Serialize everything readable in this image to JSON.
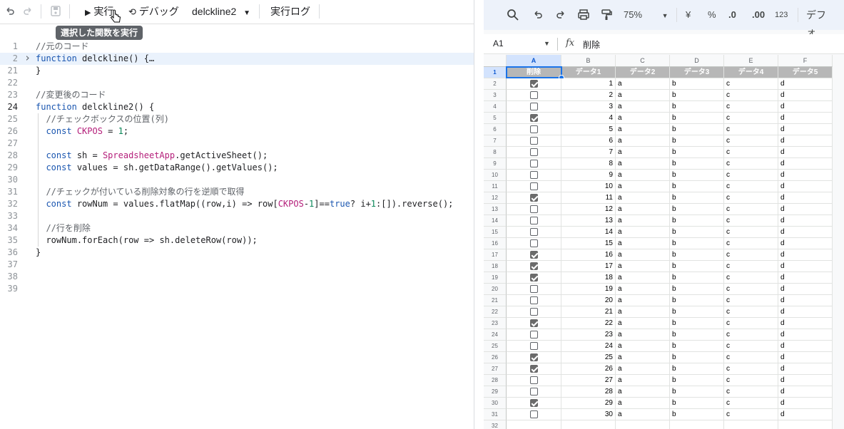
{
  "editor": {
    "toolbar": {
      "run_label": "実行",
      "debug_label": "デバッグ",
      "function_select": "delckline2",
      "log_label": "実行ログ"
    },
    "tooltip": "選択した関数を実行",
    "lines": [
      {
        "n": "1",
        "t": "//元のコード"
      },
      {
        "n": "2",
        "t": "function delckline() {…"
      },
      {
        "n": "21",
        "t": "}"
      },
      {
        "n": "22",
        "t": ""
      },
      {
        "n": "23",
        "t": "//変更後のコード"
      },
      {
        "n": "24",
        "t": "function delckline2() {"
      },
      {
        "n": "25",
        "t": "  //チェックボックスの位置(列)"
      },
      {
        "n": "26",
        "t": "  const CKPOS = 1;"
      },
      {
        "n": "27",
        "t": ""
      },
      {
        "n": "28",
        "t": "  const sh = SpreadsheetApp.getActiveSheet();"
      },
      {
        "n": "29",
        "t": "  const values = sh.getDataRange().getValues();"
      },
      {
        "n": "30",
        "t": ""
      },
      {
        "n": "31",
        "t": "  //チェックが付いている削除対象の行を逆順で取得"
      },
      {
        "n": "32",
        "t": "  const rowNum = values.flatMap((row,i) => row[CKPOS-1]==true? i+1:[]).reverse();"
      },
      {
        "n": "33",
        "t": ""
      },
      {
        "n": "34",
        "t": "  //行を削除"
      },
      {
        "n": "35",
        "t": "  rowNum.forEach(row => sh.deleteRow(row));"
      },
      {
        "n": "36",
        "t": "}"
      },
      {
        "n": "37",
        "t": ""
      },
      {
        "n": "38",
        "t": ""
      },
      {
        "n": "39",
        "t": ""
      }
    ]
  },
  "sheets": {
    "toolbar": {
      "zoom": "75%",
      "currency": "¥",
      "percent": "%",
      "dec_decrease": ".0",
      "dec_increase": ".00",
      "number_format": "123",
      "font": "デフォ..."
    },
    "name_box": "A1",
    "formula": "削除",
    "columns": [
      "A",
      "B",
      "C",
      "D",
      "E",
      "F"
    ],
    "header_row": [
      "削除",
      "データ1",
      "データ2",
      "データ3",
      "データ4",
      "データ5"
    ],
    "rows": [
      {
        "n": "2",
        "checked": true,
        "v": "1"
      },
      {
        "n": "3",
        "checked": false,
        "v": "2"
      },
      {
        "n": "4",
        "checked": false,
        "v": "3"
      },
      {
        "n": "5",
        "checked": true,
        "v": "4"
      },
      {
        "n": "6",
        "checked": false,
        "v": "5"
      },
      {
        "n": "7",
        "checked": false,
        "v": "6"
      },
      {
        "n": "8",
        "checked": false,
        "v": "7"
      },
      {
        "n": "9",
        "checked": false,
        "v": "8"
      },
      {
        "n": "10",
        "checked": false,
        "v": "9"
      },
      {
        "n": "11",
        "checked": false,
        "v": "10"
      },
      {
        "n": "12",
        "checked": true,
        "v": "11"
      },
      {
        "n": "13",
        "checked": false,
        "v": "12"
      },
      {
        "n": "14",
        "checked": false,
        "v": "13"
      },
      {
        "n": "15",
        "checked": false,
        "v": "14"
      },
      {
        "n": "16",
        "checked": false,
        "v": "15"
      },
      {
        "n": "17",
        "checked": true,
        "v": "16"
      },
      {
        "n": "18",
        "checked": true,
        "v": "17"
      },
      {
        "n": "19",
        "checked": true,
        "v": "18"
      },
      {
        "n": "20",
        "checked": false,
        "v": "19"
      },
      {
        "n": "21",
        "checked": false,
        "v": "20"
      },
      {
        "n": "22",
        "checked": false,
        "v": "21"
      },
      {
        "n": "23",
        "checked": true,
        "v": "22"
      },
      {
        "n": "24",
        "checked": false,
        "v": "23"
      },
      {
        "n": "25",
        "checked": false,
        "v": "24"
      },
      {
        "n": "26",
        "checked": true,
        "v": "25"
      },
      {
        "n": "27",
        "checked": true,
        "v": "26"
      },
      {
        "n": "28",
        "checked": false,
        "v": "27"
      },
      {
        "n": "29",
        "checked": false,
        "v": "28"
      },
      {
        "n": "30",
        "checked": true,
        "v": "29"
      },
      {
        "n": "31",
        "checked": false,
        "v": "30"
      }
    ],
    "last_row_num": "32",
    "cell_c": "a",
    "cell_d": "b",
    "cell_e": "c",
    "cell_f": "d"
  }
}
